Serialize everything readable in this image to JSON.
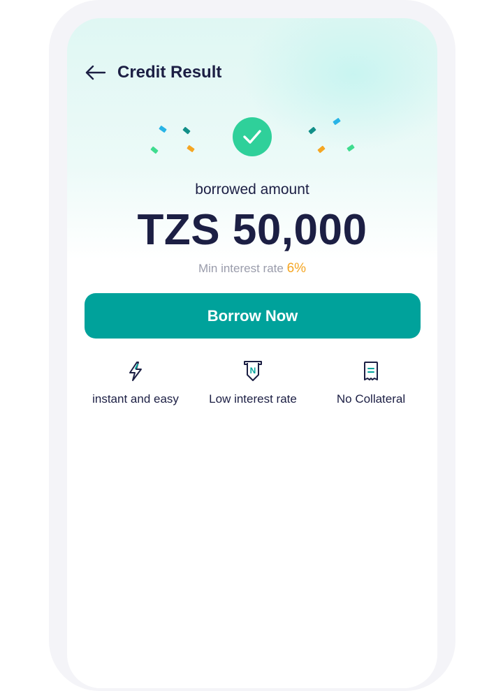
{
  "header": {
    "back_icon": "arrow-left-icon",
    "title": "Credit Result"
  },
  "result": {
    "status_icon": "check-circle-icon",
    "amount_label": "borrowed amount",
    "amount_value": "TZS 50,000",
    "rate_label": "Min interest rate",
    "rate_value": "6%"
  },
  "cta": {
    "borrow_label": "Borrow Now"
  },
  "features": [
    {
      "icon": "lightning-icon",
      "label": "instant and easy"
    },
    {
      "icon": "low-rate-icon",
      "label": "Low interest rate"
    },
    {
      "icon": "receipt-icon",
      "label": "No Collateral"
    }
  ],
  "colors": {
    "primary": "#00a29b",
    "success": "#2fd09a",
    "accent": "#f5a623",
    "text_dark": "#1c1f44",
    "text_muted": "#9a9cab"
  }
}
